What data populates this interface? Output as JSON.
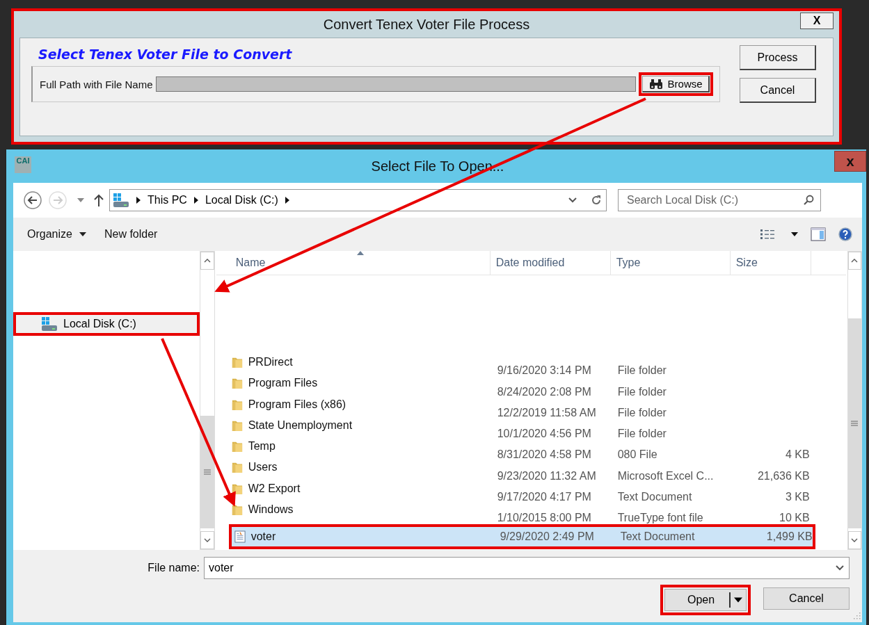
{
  "top_window": {
    "title": "Convert Tenex Voter File Process",
    "close": "X",
    "heading": "Select Tenex Voter File to Convert",
    "path_label": "Full Path with File Name",
    "browse": "Browse",
    "buttons": [
      "Process",
      "Cancel"
    ]
  },
  "dialog": {
    "logo": "CAI",
    "title": "Select File To Open...",
    "close": "x",
    "breadcrumb": [
      "This PC",
      "Local Disk (C:)"
    ],
    "search": {
      "placeholder": "Search Local Disk (C:)"
    },
    "toolbar": [
      "Organize",
      "New folder"
    ],
    "nav_items": [
      {
        "label": "Local Disk (C:)",
        "selected": true
      }
    ],
    "columns": [
      "Name",
      "Date modified",
      "Type",
      "Size"
    ],
    "files": [
      {
        "kind": "folder",
        "name": "PRDirect",
        "date": "9/16/2020 3:14 PM",
        "type": "File folder",
        "selected": false
      },
      {
        "kind": "folder",
        "name": "Program Files",
        "date": "8/24/2020 2:08 PM",
        "type": "File folder",
        "selected": false
      },
      {
        "kind": "folder",
        "name": "Program Files (x86)",
        "date": "12/2/2019 11:58 AM",
        "type": "File folder",
        "selected": false
      },
      {
        "kind": "folder",
        "name": "State Unemployment",
        "date": "10/1/2020 4:56 PM",
        "type": "File folder",
        "selected": false
      },
      {
        "kind": "folder",
        "name": "Temp",
        "date": "8/31/2020 4:58 PM",
        "type": "080 File",
        "size": "4 KB",
        "selected": false
      },
      {
        "kind": "folder",
        "name": "Users",
        "date": "9/23/2020 11:32 AM",
        "type": "Microsoft Excel C...",
        "size": "21,636 KB",
        "selected": false
      },
      {
        "kind": "folder",
        "name": "W2 Export",
        "date": "9/17/2020 4:17 PM",
        "type": "Text Document",
        "size": "3 KB",
        "selected": false
      },
      {
        "kind": "folder",
        "name": "Windows",
        "date": "1/10/2015 8:00 PM",
        "type": "TrueType font file",
        "size": "10 KB",
        "selected": false
      },
      {
        "kind": "text",
        "name": "voter",
        "date": "9/29/2020 2:49 PM",
        "type": "Text Document",
        "size": "1,499 KB",
        "selected": true
      }
    ],
    "file_name": {
      "label": "File name:",
      "value": "voter"
    },
    "buttons": [
      "Open",
      "Cancel"
    ]
  }
}
